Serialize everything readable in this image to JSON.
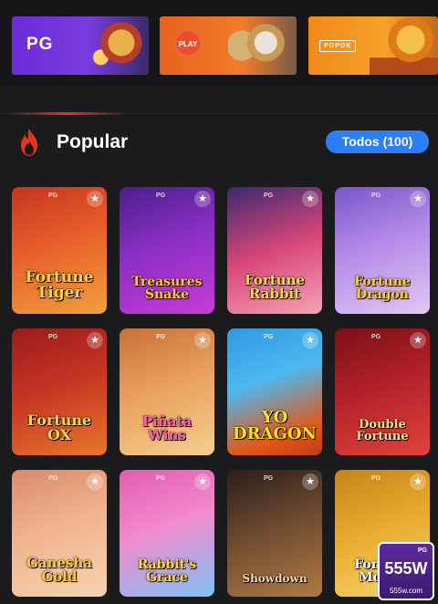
{
  "providers": [
    {
      "label": "PG"
    },
    {
      "label": "PLAY"
    },
    {
      "label": "POPOK"
    }
  ],
  "header": {
    "title": "Popular",
    "todos_label": "Todos (100)"
  },
  "colors": {
    "accent": "#2d7df5",
    "background": "#1b1b1d",
    "fire": "#e8341c"
  },
  "games": [
    {
      "name": "Fortune Tiger",
      "bg": "linear-gradient(160deg,#c2361e 0%,#e6592a 40%,#f2a03a 100%)",
      "color": "#ffd24a",
      "size": 17
    },
    {
      "name": "Treasures Snake",
      "bg": "linear-gradient(160deg,#4a1f8c 0%,#8a2fc4 45%,#c73bd6 100%)",
      "color": "#ffc93c",
      "size": 14
    },
    {
      "name": "Fortune Rabbit",
      "bg": "linear-gradient(160deg,#3a2a6e 0%,#d8467a 50%,#f4a3b2 100%)",
      "color": "#ffd84a",
      "size": 15
    },
    {
      "name": "Fortune Dragon",
      "bg": "linear-gradient(160deg,#7a56c8 0%,#b48ae8 45%,#e2c8f2 100%)",
      "color": "#ffce3a",
      "size": 14
    },
    {
      "name": "Fortune OX",
      "bg": "linear-gradient(160deg,#9a1c1c 0%,#c53422 45%,#e9762c 100%)",
      "color": "#ffd24a",
      "size": 16
    },
    {
      "name": "Piñata Wins",
      "bg": "linear-gradient(160deg,#c7703a 0%,#e8a05c 45%,#f3cf8e 100%)",
      "color": "#ff5fa8",
      "size": 15
    },
    {
      "name": "YO DRAGON",
      "bg": "linear-gradient(160deg,#2f9ae0 0%,#4cb8f0 40%,#e2581a 80%,#c23b12 100%)",
      "color": "#ffde2a",
      "size": 18
    },
    {
      "name": "Double Fortune",
      "bg": "linear-gradient(160deg,#7a0f14 0%,#b3202a 45%,#e0443a 100%)",
      "color": "#ffe08a",
      "size": 13
    },
    {
      "name": "Ganesha Gold",
      "bg": "linear-gradient(160deg,#d98a6a 0%,#f0b48e 45%,#f6d2b0 100%)",
      "color": "#ffc83a",
      "size": 15
    },
    {
      "name": "Rabbit's Grace",
      "bg": "linear-gradient(160deg,#e35bb0 0%,#f18bcc 45%,#7fc0f4 100%)",
      "color": "#ffd54a",
      "size": 14
    },
    {
      "name": "Showdown",
      "bg": "linear-gradient(160deg,#2a1e1a 0%,#6b4a2e 45%,#b07a44 100%)",
      "color": "#f2d9a8",
      "size": 12
    },
    {
      "name": "Fortune Mouse",
      "bg": "linear-gradient(160deg,#c58418 0%,#e8aa2e 45%,#f6d36a 100%)",
      "color": "#ffffff",
      "size": 14
    }
  ],
  "brand": {
    "top": "PG",
    "main": "555W",
    "sub": "555w.com"
  }
}
